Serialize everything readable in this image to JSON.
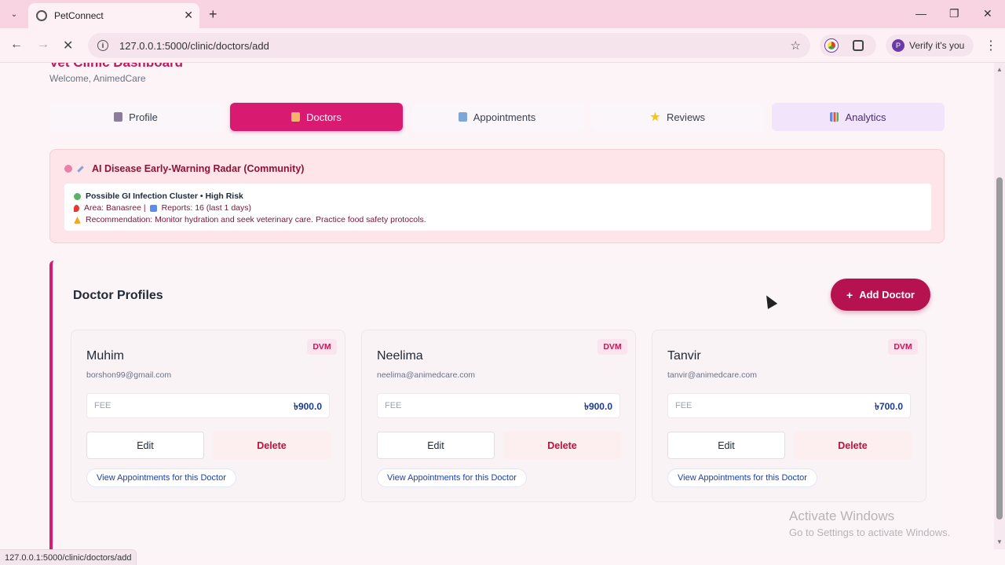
{
  "browser": {
    "tab_title": "PetConnect",
    "url": "127.0.0.1:5000/clinic/doctors/add",
    "profile_label": "Verify it's you",
    "profile_initial": "P",
    "status_url": "127.0.0.1:5000/clinic/doctors/add"
  },
  "page": {
    "title": "Vet Clinic Dashboard",
    "welcome": "Welcome, AnimedCare"
  },
  "nav_tabs": [
    {
      "label": "Profile",
      "icon": "profile-icon"
    },
    {
      "label": "Doctors",
      "icon": "doctor-icon"
    },
    {
      "label": "Appointments",
      "icon": "calendar-icon"
    },
    {
      "label": "Reviews",
      "icon": "star-icon"
    },
    {
      "label": "Analytics",
      "icon": "chart-icon"
    }
  ],
  "radar": {
    "title": "AI Disease Early-Warning Radar (Community)",
    "alert_title": "Possible GI Infection Cluster • High Risk",
    "area_line_a": "Area: Banasree |",
    "area_line_b": "Reports: 16 (last 1 days)",
    "recommendation": "Recommendation: Monitor hydration and seek veterinary care. Practice food safety protocols."
  },
  "profiles": {
    "title": "Doctor Profiles",
    "add_label": "Add Doctor",
    "add_icon": "+",
    "doctors": [
      {
        "name": "Muhim",
        "badge": "DVM",
        "email": "borshon99@gmail.com",
        "fee_label": "FEE",
        "fee": "৳900.0",
        "edit": "Edit",
        "delete": "Delete",
        "view": "View Appointments for this Doctor"
      },
      {
        "name": "Neelima",
        "badge": "DVM",
        "email": "neelima@animedcare.com",
        "fee_label": "FEE",
        "fee": "৳900.0",
        "edit": "Edit",
        "delete": "Delete",
        "view": "View Appointments for this Doctor"
      },
      {
        "name": "Tanvir",
        "badge": "DVM",
        "email": "tanvir@animedcare.com",
        "fee_label": "FEE",
        "fee": "৳700.0",
        "edit": "Edit",
        "delete": "Delete",
        "view": "View Appointments for this Doctor"
      }
    ]
  },
  "watermark": {
    "line1": "Activate Windows",
    "line2": "Go to Settings to activate Windows."
  },
  "colors": {
    "accent": "#d81b70",
    "add_button": "#b5124f",
    "radar_bg": "#fde5e9"
  }
}
